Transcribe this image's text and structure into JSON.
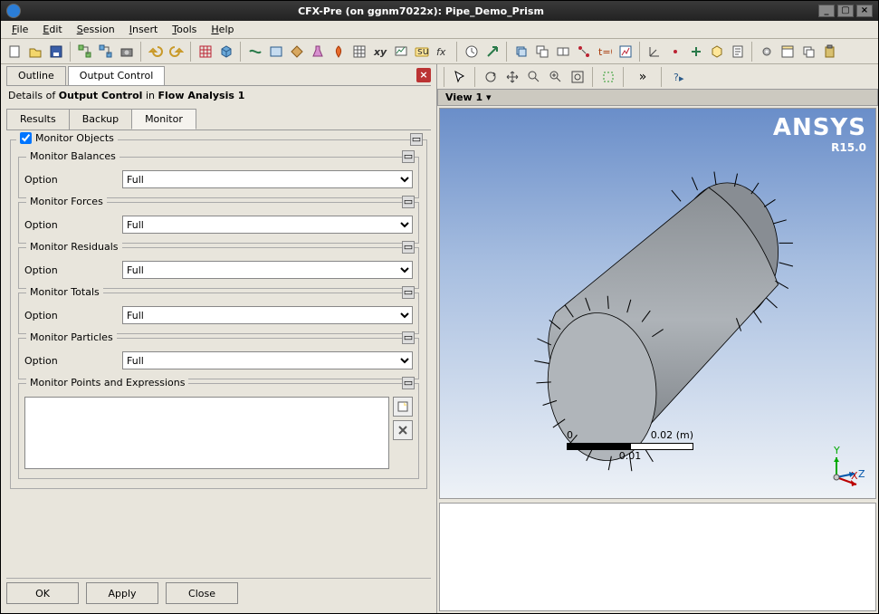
{
  "window": {
    "title": "CFX-Pre (on ggnm7022x):  Pipe_Demo_Prism"
  },
  "menu": {
    "file": "File",
    "edit": "Edit",
    "session": "Session",
    "insert": "Insert",
    "tools": "Tools",
    "help": "Help"
  },
  "top_tabs": {
    "outline": "Outline",
    "output_control": "Output Control"
  },
  "details_prefix": "Details of ",
  "details_item": "Output Control",
  "details_mid": " in ",
  "details_analysis": "Flow Analysis 1",
  "sub_tabs": {
    "results": "Results",
    "backup": "Backup",
    "monitor": "Monitor"
  },
  "monitor_objects_label": "Monitor Objects",
  "groups": {
    "balances": {
      "title": "Monitor Balances",
      "opt_label": "Option",
      "opt_value": "Full"
    },
    "forces": {
      "title": "Monitor Forces",
      "opt_label": "Option",
      "opt_value": "Full"
    },
    "residuals": {
      "title": "Monitor Residuals",
      "opt_label": "Option",
      "opt_value": "Full"
    },
    "totals": {
      "title": "Monitor Totals",
      "opt_label": "Option",
      "opt_value": "Full"
    },
    "particles": {
      "title": "Monitor Particles",
      "opt_label": "Option",
      "opt_value": "Full"
    },
    "points": {
      "title": "Monitor Points and Expressions"
    }
  },
  "buttons": {
    "ok": "OK",
    "apply": "Apply",
    "close": "Close"
  },
  "view": {
    "label": "View 1 ▾"
  },
  "logo": {
    "brand": "ANSYS",
    "ver": "R15.0"
  },
  "scale": {
    "left": "0",
    "right": "0.02",
    "unit": "(m)",
    "mid": "0.01"
  },
  "triad": {
    "x": "X",
    "y": "Y",
    "z": "Z"
  }
}
